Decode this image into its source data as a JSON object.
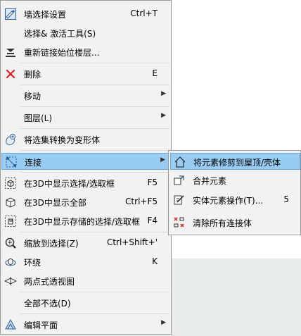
{
  "menu": {
    "items": [
      {
        "label": "墙选择设置",
        "shortcut": "Ctrl+T",
        "icon": "wall-settings-icon"
      },
      {
        "label": "选择& 激活工具(S)",
        "shortcut": "",
        "icon": ""
      },
      {
        "label": "重新链接始位楼层...",
        "shortcut": "",
        "icon": "relink-story-icon"
      },
      {
        "label": "删除",
        "shortcut": "E",
        "icon": "delete-x-icon"
      },
      {
        "label": "移动",
        "shortcut": "",
        "icon": "",
        "submenu": true
      },
      {
        "label": "图层(L)",
        "shortcut": "",
        "icon": "",
        "submenu": true
      },
      {
        "label": "将选集转换为变形体",
        "shortcut": "",
        "icon": "morph-convert-icon"
      },
      {
        "label": "连接",
        "shortcut": "",
        "icon": "connect-icon",
        "submenu": true
      },
      {
        "label": "在3D中显示选择/选取框",
        "shortcut": "F5",
        "icon": "show-3d-selection-icon"
      },
      {
        "label": "在3D中显示全部",
        "shortcut": "Ctrl+F5",
        "icon": "show-3d-all-icon"
      },
      {
        "label": "在3D中显示存储的选择/选取框",
        "shortcut": "F4",
        "icon": "show-3d-stored-icon"
      },
      {
        "label": "缩放到选择(Z)",
        "shortcut": "Ctrl+Shift+'",
        "icon": "zoom-selection-icon"
      },
      {
        "label": "环绕",
        "shortcut": "K",
        "icon": "orbit-icon"
      },
      {
        "label": "两点式透视图",
        "shortcut": "",
        "icon": "two-point-perspective-icon"
      },
      {
        "label": "全部不选(D)",
        "shortcut": "",
        "icon": ""
      },
      {
        "label": "编辑平面",
        "shortcut": "",
        "icon": "edit-plane-icon",
        "submenu": true
      }
    ]
  },
  "submenu": {
    "items": [
      {
        "label": "将元素修剪到屋顶/壳体",
        "shortcut": "",
        "icon": "trim-roof-icon"
      },
      {
        "label": "合并元素",
        "shortcut": "",
        "icon": "merge-elements-icon"
      },
      {
        "label": "实体元素操作(T)...",
        "shortcut": "5",
        "icon": "solid-operations-icon"
      },
      {
        "label": "清除所有连接体",
        "shortcut": "",
        "icon": "clear-connections-icon"
      }
    ]
  },
  "colors": {
    "highlight": "#99ccf2",
    "menu_bg": "#f2f2f2",
    "delete": "#e02020"
  }
}
